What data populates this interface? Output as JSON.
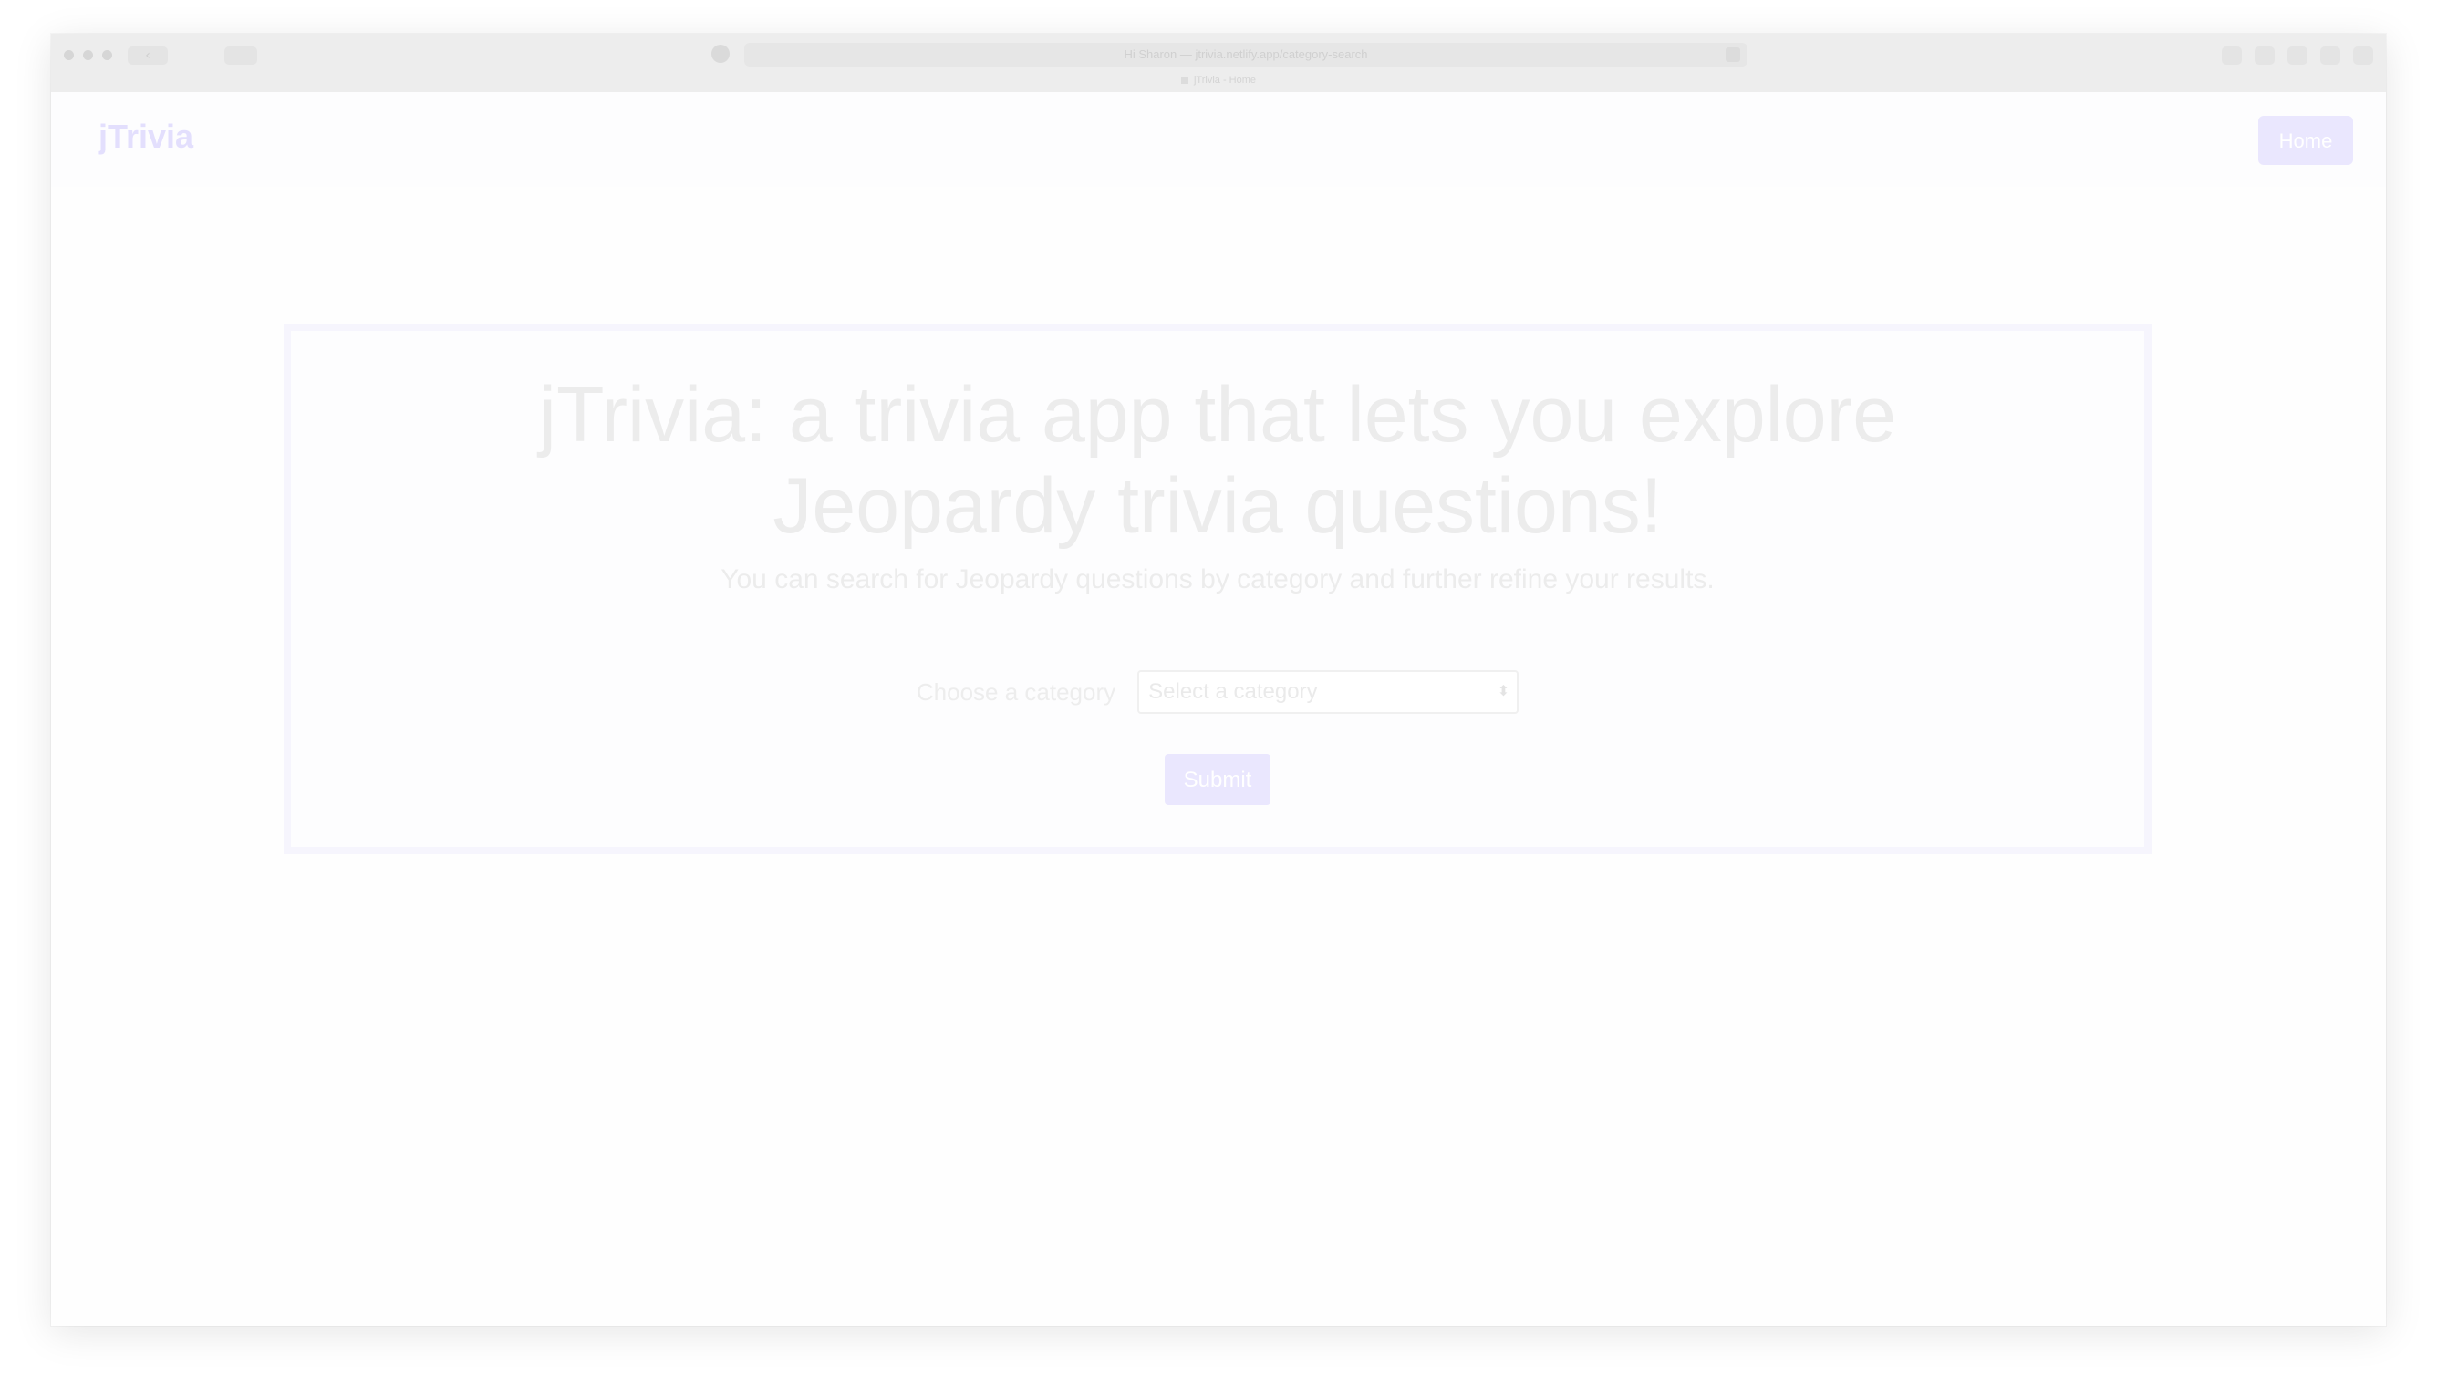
{
  "browser": {
    "url": "Hi Sharon — jtrivia.netlify.app/category-search",
    "tab_title": "jTrivia - Home",
    "back_icon": "chevron-left-icon",
    "forward_icon": "chevron-right-icon"
  },
  "navbar": {
    "brand": "jTrivia",
    "home_label": "Home",
    "accent_color": "#6c5ce7"
  },
  "hero": {
    "title_line1": "jTrivia: a trivia app that lets you explore",
    "title_line2": "Jeopardy trivia questions!",
    "subtitle": "You can search for Jeopardy questions by category and further refine your results."
  },
  "form": {
    "label": "Choose a category",
    "select_value": "Select a category",
    "submit_label": "Submit"
  }
}
